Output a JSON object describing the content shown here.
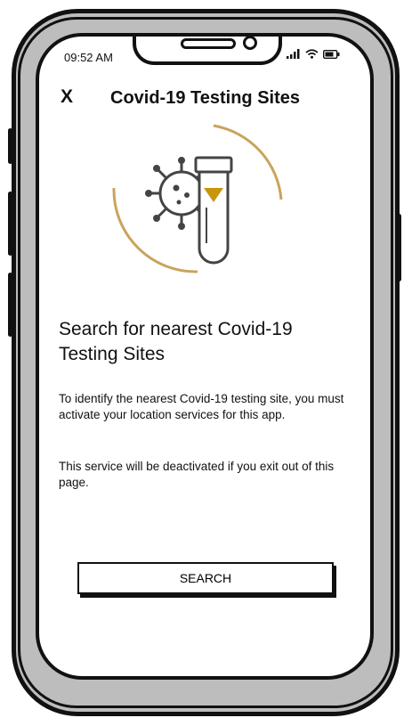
{
  "status_bar": {
    "time": "09:52 AM"
  },
  "header": {
    "close_label": "X",
    "title": "Covid-19 Testing Sites"
  },
  "hero": {
    "icon_name": "covid-test-tube-icon",
    "accent_color": "#c9a45c",
    "fill_color": "#c8960c"
  },
  "content": {
    "heading": "Search for nearest Covid-19 Testing Sites",
    "paragraph_1": "To identify the nearest Covid-19 testing site, you must activate your location services for this app.",
    "paragraph_2": "This service will be deactivated if you exit out of this page."
  },
  "actions": {
    "search_label": "SEARCH"
  }
}
